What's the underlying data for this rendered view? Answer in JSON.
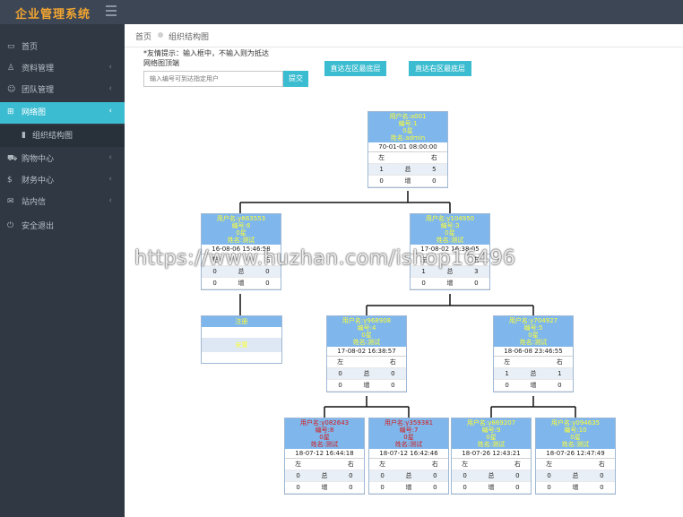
{
  "app": {
    "title": "企业管理系统"
  },
  "sidebar": {
    "items": [
      {
        "label": "首页",
        "icon": "monitor-icon",
        "arrow": ""
      },
      {
        "label": "资料管理",
        "icon": "user-icon",
        "arrow": "‹"
      },
      {
        "label": "团队管理",
        "icon": "users-icon",
        "arrow": "‹"
      },
      {
        "label": "网络图",
        "icon": "sitemap-icon",
        "arrow": "‹"
      },
      {
        "label": "组织结构图",
        "icon": "bar-chart-icon",
        "arrow": ""
      },
      {
        "label": "购物中心",
        "icon": "cart-icon",
        "arrow": "‹"
      },
      {
        "label": "财务中心",
        "icon": "dollar-icon",
        "arrow": "‹"
      },
      {
        "label": "站内信",
        "icon": "mail-icon",
        "arrow": "‹"
      },
      {
        "label": "安全退出",
        "icon": "power-icon",
        "arrow": ""
      }
    ]
  },
  "breadcrumb": {
    "home": "首页",
    "current": "组织结构图"
  },
  "tip": "*友情提示：输入框中，不输入则为抵达网络图顶端",
  "search": {
    "placeholder": "输入编号可到达指定用户",
    "submit_label": "提交"
  },
  "buttons": {
    "left_bottom": "直达左区最底层",
    "right_bottom": "直达右区最底层"
  },
  "tree": {
    "labels": {
      "left": "左",
      "right": "右",
      "total": "总",
      "new": "增"
    },
    "nodes": [
      {
        "user": "用户名:a001",
        "no": "编号:1",
        "star": "0星",
        "name": "姓名:admin",
        "time": "70-01-01 08:00:00",
        "t": [
          "1",
          "5"
        ],
        "n": [
          "0",
          "0"
        ],
        "red": false
      },
      {
        "user": "用户名:y863553",
        "no": "编号:6",
        "star": "0星",
        "name": "姓名:测试",
        "time": "16-08-06 15:46:58",
        "t": [
          "0",
          "0"
        ],
        "n": [
          "0",
          "0"
        ],
        "red": false
      },
      {
        "user": "用户名:y104950",
        "no": "编号:3",
        "star": "0星",
        "name": "姓名:测试",
        "time": "17-08-02 16:38:05",
        "t": [
          "1",
          "3"
        ],
        "n": [
          "0",
          "0"
        ],
        "red": false
      },
      {
        "user": "用户名:y968908",
        "no": "编号:4",
        "star": "0星",
        "name": "姓名:测试",
        "time": "17-08-02 16:38:57",
        "t": [
          "0",
          "0"
        ],
        "n": [
          "0",
          "0"
        ],
        "red": false
      },
      {
        "user": "用户名:y704927",
        "no": "编号:5",
        "star": "0星",
        "name": "姓名:测试",
        "time": "18-06-08 23:46:55",
        "t": [
          "1",
          "1"
        ],
        "n": [
          "0",
          "0"
        ],
        "red": false
      },
      {
        "user": "用户名:y082643",
        "no": "编号:8",
        "star": "0星",
        "name": "姓名:测试",
        "time": "18-07-12 16:44:18",
        "t": [
          "0",
          "0"
        ],
        "n": [
          "0",
          "0"
        ],
        "red": true
      },
      {
        "user": "用户名:y359381",
        "no": "编号:7",
        "star": "0星",
        "name": "姓名:测试",
        "time": "18-07-12 16:42:46",
        "t": [
          "0",
          "0"
        ],
        "n": [
          "0",
          "0"
        ],
        "red": true
      },
      {
        "user": "用户名:y869207",
        "no": "编号:9",
        "star": "0星",
        "name": "姓名:测试",
        "time": "18-07-26 12:43:21",
        "t": [
          "0",
          "0"
        ],
        "n": [
          "0",
          "0"
        ],
        "red": false
      },
      {
        "user": "用户名:y094635",
        "no": "编号:10",
        "star": "0星",
        "name": "姓名:测试",
        "time": "18-07-26 12:47:49",
        "t": [
          "0",
          "0"
        ],
        "n": [
          "0",
          "0"
        ],
        "red": false
      }
    ],
    "empty_slot": {
      "register": "注册",
      "placement": "安置"
    }
  },
  "watermark": "https://www.huzhan.com/ishop16496",
  "colors": {
    "accent": "#3cbcd0",
    "sidebar": "#2f3843",
    "node_header": "#7fb7ec",
    "name_yellow": "#ffff33",
    "name_red": "#d21c1c"
  }
}
